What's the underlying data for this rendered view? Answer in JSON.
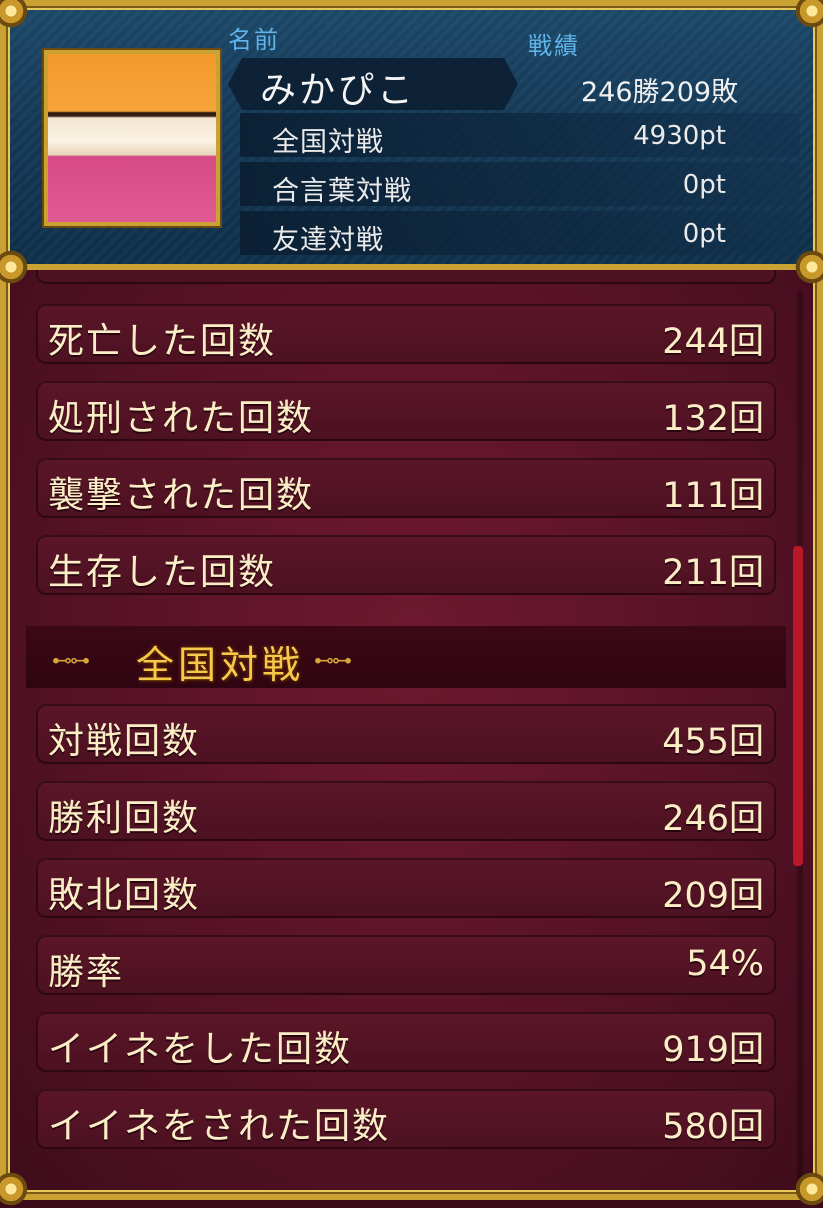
{
  "header": {
    "name_label": "名前",
    "record_label": "戦績",
    "player_name": "みかぴこ",
    "record": "246勝209敗",
    "points": [
      {
        "label": "全国対戦",
        "value": "4930pt"
      },
      {
        "label": "合言葉対戦",
        "value": "0pt"
      },
      {
        "label": "友達対戦",
        "value": "0pt"
      }
    ]
  },
  "stats_top": [
    {
      "label": "死亡した回数",
      "value": "244回"
    },
    {
      "label": "処刑された回数",
      "value": "132回"
    },
    {
      "label": "襲撃された回数",
      "value": "111回"
    },
    {
      "label": "生存した回数",
      "value": "211回"
    }
  ],
  "section": {
    "title": "全国対戦"
  },
  "stats_section": [
    {
      "label": "対戦回数",
      "value": "455回"
    },
    {
      "label": "勝利回数",
      "value": "246回"
    },
    {
      "label": "敗北回数",
      "value": "209回"
    },
    {
      "label": "勝率",
      "value": "54%"
    },
    {
      "label": "イイネをした回数",
      "value": "919回"
    },
    {
      "label": "イイネをされた回数",
      "value": "580回"
    }
  ],
  "colors": {
    "header_bg": "#153a58",
    "panel_bg": "#561226",
    "gold": "#c9a233",
    "label_blue": "#5fb4ea",
    "stat_text": "#fbeec6",
    "section_title": "#f6c84b",
    "scroll_thumb": "#b8182a"
  }
}
